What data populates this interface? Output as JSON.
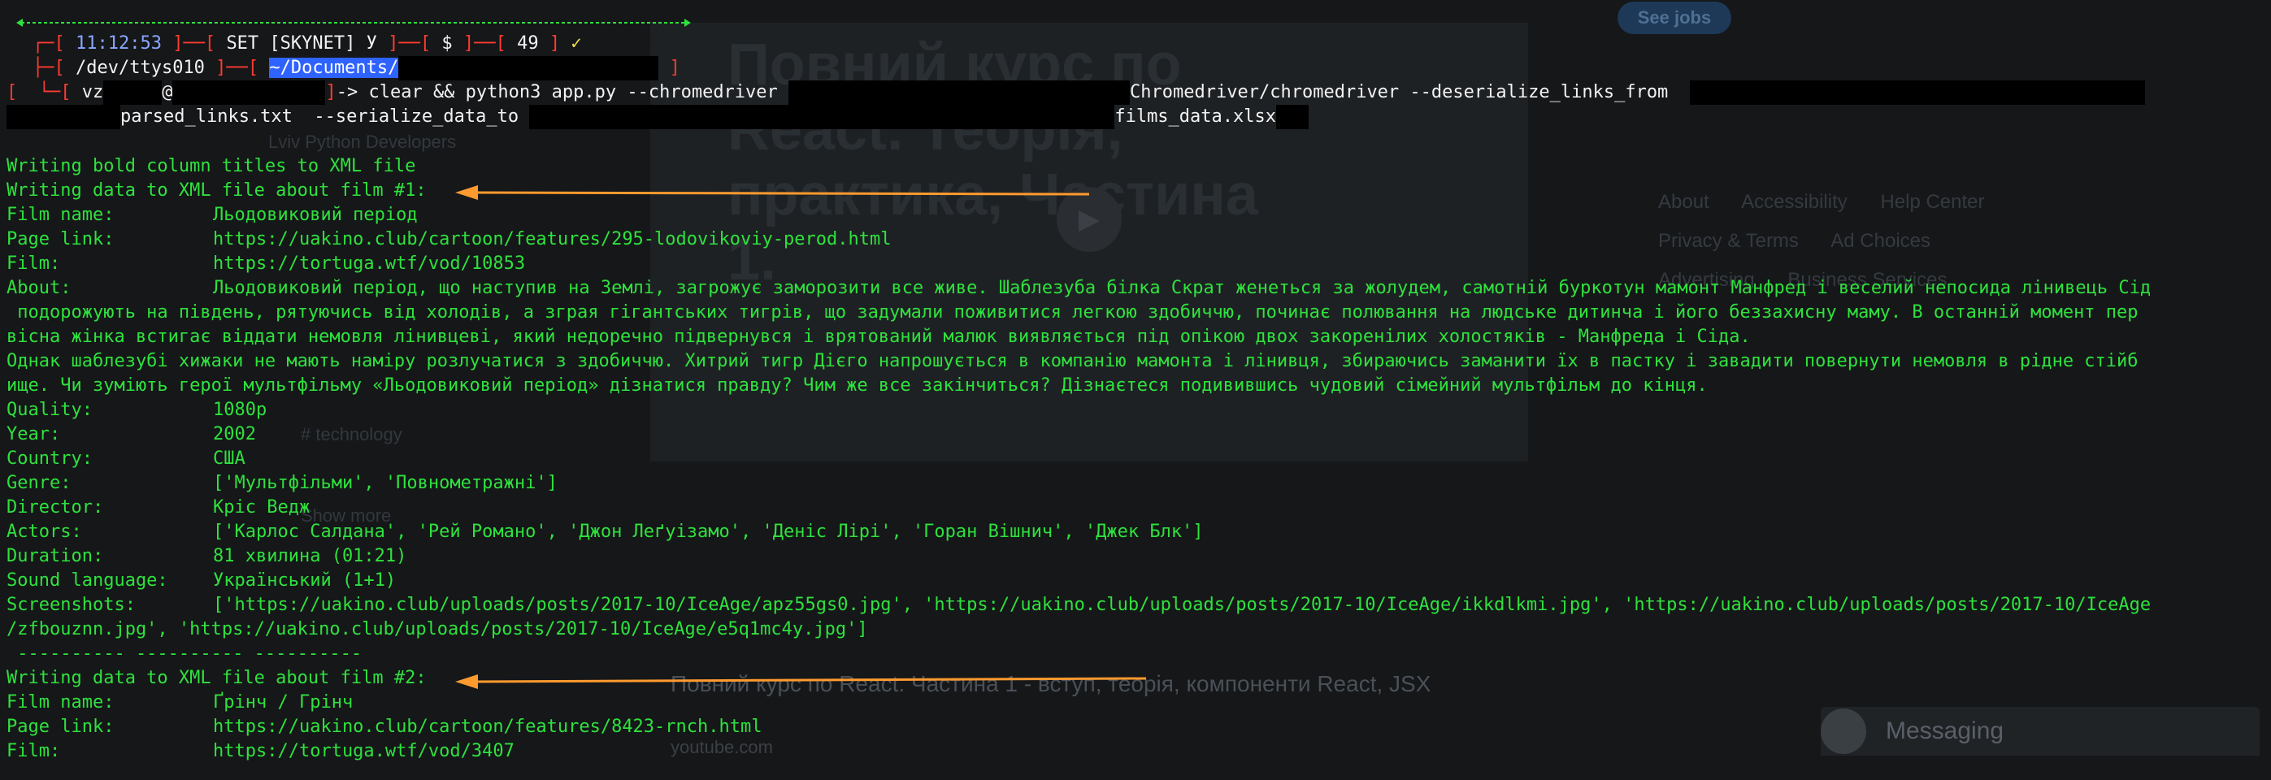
{
  "background": {
    "see_jobs": "See jobs",
    "course_title": "Повний курс по React. Теорія, практика, Частина 1.",
    "footer_links_row1": [
      "About",
      "Accessibility",
      "Help Center"
    ],
    "footer_links_row2": [
      "Privacy & Terms",
      "Ad Choices"
    ],
    "footer_links_row3": [
      "Advertising",
      "Business Services"
    ],
    "left_nav": [
      "Lviv Python Developers",
      "# technology",
      "Show more"
    ],
    "card_title": "Повний курс по React. Частина 1 - вступ, теорія, компоненти React, JSX",
    "card_source": "youtube.com",
    "messaging": "Messaging"
  },
  "prompt": {
    "time": "11:12:53",
    "set_label": "SET [SKYNET] У",
    "dollar": "$",
    "exit_code": "49",
    "check": "✓",
    "tty": "/dev/ttys010",
    "cwd": "~/Documents/",
    "user_visible": "vz",
    "at": "@",
    "arrow": "->",
    "command": "clear && python3 app.py --chromedriver",
    "command_cont": "Chromedriver/chromedriver --deserialize_links_from",
    "arg2": "parsed_links.txt  --serialize_data_to",
    "arg3": "films_data.xlsx"
  },
  "output": {
    "bold_titles": "Writing bold column titles to XML file",
    "film1_header": "Writing data to XML file about film #1:",
    "film1": {
      "labels": [
        "Film name:",
        "Page link:",
        "Film:",
        "About:"
      ],
      "name": "Льодовиковий період",
      "page_link": "https://uakino.club/cartoon/features/295-lodovikoviy-perod.html",
      "film_link": "https://tortuga.wtf/vod/10853",
      "about_1": "Льодовиковий період, що наступив на Землі, загрожує заморозити все живе. Шаблезуба білка Скрат женеться за жолудем, самотній буркотун мамонт Манфред і веселий непосида лінивець Сід",
      "about_2": " подорожують на південь, рятуючись від холодів, а зграя гігантських тигрів, що задумали поживитися легкою здобиччю, починає полювання на людське дитинча і його беззахисну маму. В останній момент пер",
      "about_3": "вісна жінка встигає віддати немовля лінивцеві, який недоречно підвернувся і врятований малюк виявляється під опікою двох закоренілих холостяків - Манфреда і Сіда.",
      "about_4": "Однак шаблезубі хижаки не мають наміру розлучатися з здобиччю. Хитрий тигр Дієго напрошується в компанію мамонта і лінивця, збираючись заманити їх в пастку і завадити повернути немовля в рідне стійб",
      "about_5": "ище. Чи зуміють герої мультфільму «Льодовиковий період» дізнатися правду? Чим же все закінчиться? Дізнаєтеся подивившись чудовий сімейний мультфільм до кінця.",
      "labels2": [
        "Quality:",
        "Year:",
        "Country:",
        "Genre:",
        "Director:",
        "Actors:",
        "Duration:",
        "Sound language:",
        "Screenshots:"
      ],
      "quality": "1080p",
      "year": "2002",
      "country": "США",
      "genre": "['Мультфільми', 'Повнометражні']",
      "director": "Кріс Ведж",
      "actors": "['Карлос Салдана', 'Рей Романо', 'Джон Леґуізамо', 'Деніс Лірі', 'Горан Вішнич', 'Джек Блк']",
      "duration": "81 хвилина (01:21)",
      "sound": "Український (1+1)",
      "screenshots_1": "['https://uakino.club/uploads/posts/2017-10/IceAge/apz55gs0.jpg', 'https://uakino.club/uploads/posts/2017-10/IceAge/ikkdlkmi.jpg', 'https://uakino.club/uploads/posts/2017-10/IceAge",
      "screenshots_2": "/zfbouznn.jpg', 'https://uakino.club/uploads/posts/2017-10/IceAge/e5q1mc4y.jpg']"
    },
    "separator": " ---------- ---------- ----------",
    "film2_header": "Writing data to XML file about film #2:",
    "film2": {
      "labels": [
        "Film name:",
        "Page link:",
        "Film:"
      ],
      "name": "Ґрінч / Грінч",
      "page_link": "https://uakino.club/cartoon/features/8423-rnch.html",
      "film_link": "https://tortuga.wtf/vod/3407"
    }
  },
  "colors": {
    "terminal_text": "#2fe13d",
    "bracket_red": "#ff3b30",
    "arrow_orange": "#ff9a2e",
    "highlight_blue": "#2f63ff"
  }
}
